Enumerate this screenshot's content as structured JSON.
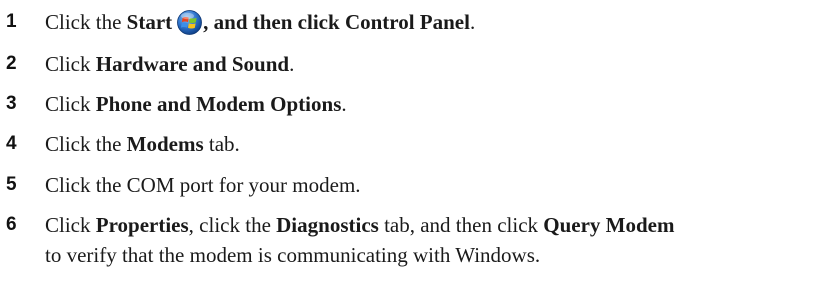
{
  "steps": [
    {
      "number": "1",
      "parts": {
        "p1": "Click the ",
        "b1": "Start",
        "p2": ", and then click ",
        "b2": "Control Panel",
        "p3": "."
      },
      "icon": "windows-start-orb-icon"
    },
    {
      "number": "2",
      "parts": {
        "p1": "Click ",
        "b1": "Hardware and Sound",
        "p2": "."
      }
    },
    {
      "number": "3",
      "parts": {
        "p1": "Click ",
        "b1": "Phone and Modem Options",
        "p2": "."
      }
    },
    {
      "number": "4",
      "parts": {
        "p1": "Click the ",
        "b1": "Modems",
        "p2": " tab."
      }
    },
    {
      "number": "5",
      "parts": {
        "p1": "Click the COM port for your modem."
      }
    },
    {
      "number": "6",
      "parts": {
        "p1": "Click ",
        "b1": "Properties",
        "p2": ", click the ",
        "b2": "Diagnostics",
        "p3": " tab, and then click ",
        "b3": "Query Modem",
        "line2": "to verify that the modem is communicating with Windows."
      }
    }
  ],
  "colors": {
    "text": "#1a1a1a",
    "start_orb_blue": "#1c5fb8",
    "logo_red": "#e8431f",
    "logo_green": "#7cc62b",
    "logo_blue": "#3c8ee8",
    "logo_yellow": "#f9c21b"
  }
}
